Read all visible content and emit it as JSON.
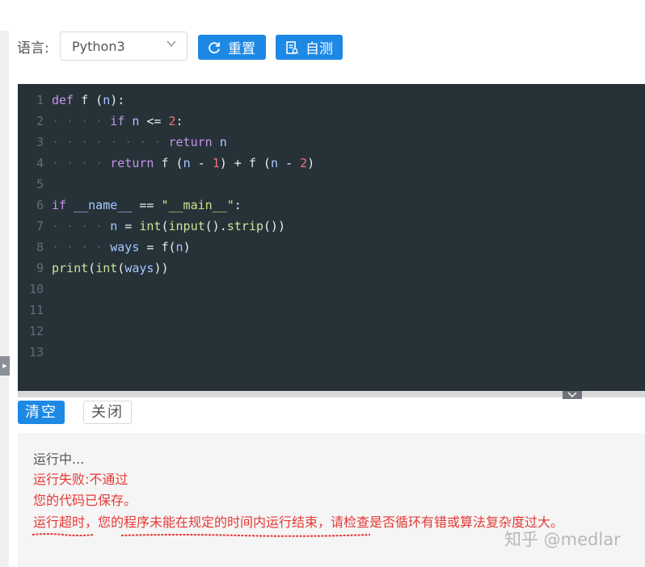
{
  "toolbar": {
    "language_label": "语言:",
    "language_value": "Python3",
    "reset_label": "重置",
    "selftest_label": "自测"
  },
  "editor": {
    "theme_bg": "#263238",
    "line_numbers": [
      "1",
      "2",
      "3",
      "4",
      "5",
      "6",
      "7",
      "8",
      "9",
      "10",
      "11",
      "12",
      "13"
    ],
    "lines": [
      "def f (n):",
      "    if n <= 2:",
      "        return n",
      "    return f (n - 1) + f (n - 2)",
      "",
      "if __name__ == \"__main__\":",
      "    n = int(input().strip())",
      "    ways = f(n)",
      "print(int(ways))",
      "",
      "",
      "",
      ""
    ]
  },
  "actions": {
    "clear_label": "清空",
    "close_label": "关闭"
  },
  "console": {
    "running": "运行中...",
    "fail": "运行失败:不通过",
    "saved": "您的代码已保存。",
    "timeout": "运行超时，您的程序未能在规定的时间内运行结束，请检查是否循环有错或算法复杂度过大。"
  },
  "watermark": "知乎 @medlar",
  "colors": {
    "accent": "#1e88e5",
    "error": "#e53935"
  },
  "icons": {
    "reset": "refresh-icon",
    "selftest": "document-icon",
    "dropdown": "chevron-down-icon",
    "collapse": "chevron-down-icon",
    "side_toggle": "chevron-right-icon"
  }
}
